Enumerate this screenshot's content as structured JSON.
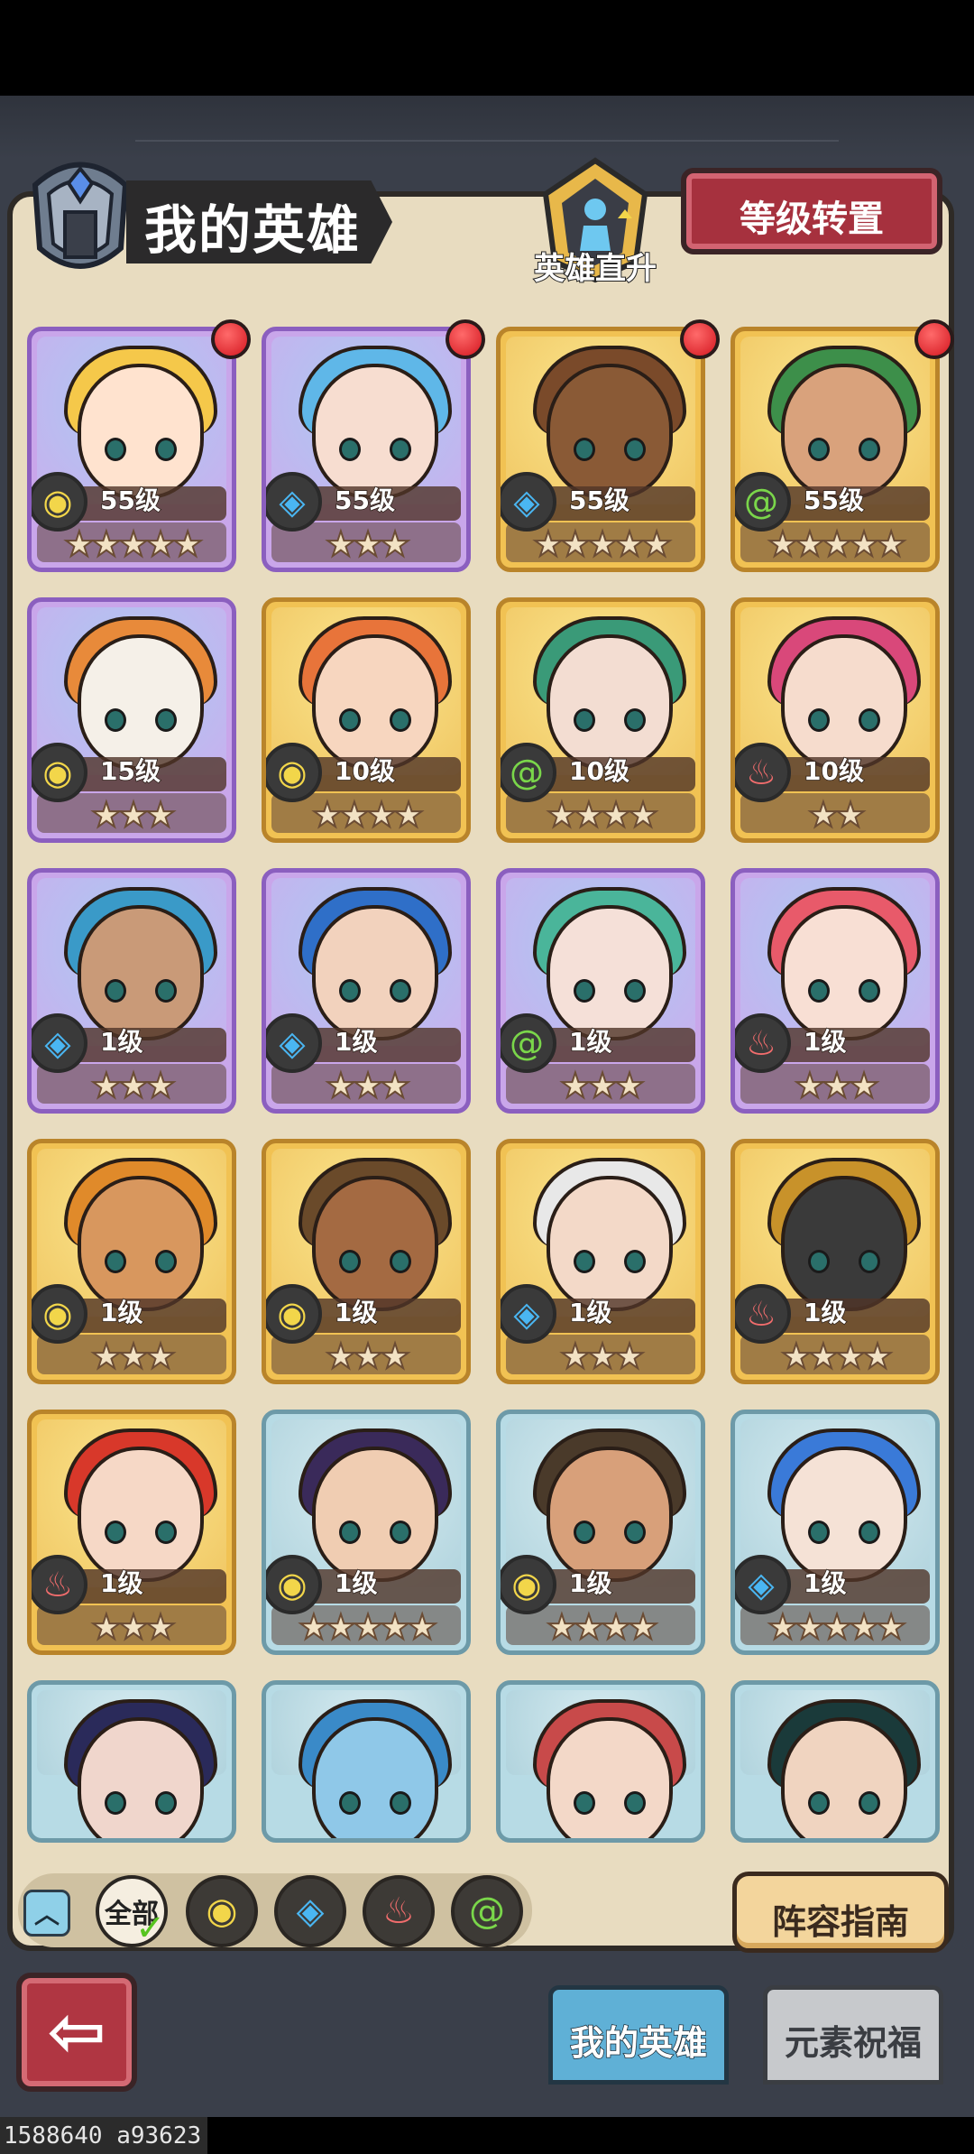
{
  "header": {
    "title": "我的英雄",
    "promote_label": "英雄直升",
    "transfer_label": "等级转置"
  },
  "heroes": [
    {
      "level": "55级",
      "stars": "★★★★★",
      "element": "earth",
      "frame": "purple",
      "hair": "#f5c84a",
      "skin": "#ffe3cf",
      "notify": true
    },
    {
      "level": "55级",
      "stars": "★★★",
      "element": "water",
      "frame": "purple",
      "hair": "#5fb7e8",
      "skin": "#f7ddd0",
      "notify": true
    },
    {
      "level": "55级",
      "stars": "★★★★★",
      "element": "water",
      "frame": "gold",
      "hair": "#7a4a2a",
      "skin": "#8a5a36",
      "notify": true
    },
    {
      "level": "55级",
      "stars": "★★★★★",
      "element": "wind",
      "frame": "gold",
      "hair": "#3d8f4a",
      "skin": "#d9a27c",
      "notify": true
    },
    {
      "level": "15级",
      "stars": "★★★",
      "element": "earth",
      "frame": "purple",
      "hair": "#e88a3a",
      "skin": "#f5f0e8",
      "notify": false
    },
    {
      "level": "10级",
      "stars": "★★★★",
      "element": "earth",
      "frame": "gold",
      "hair": "#e8743a",
      "skin": "#f7d6bf",
      "notify": false
    },
    {
      "level": "10级",
      "stars": "★★★★",
      "element": "wind",
      "frame": "gold",
      "hair": "#3a9a78",
      "skin": "#f3ddd2",
      "notify": false
    },
    {
      "level": "10级",
      "stars": "★★",
      "element": "fire",
      "frame": "gold",
      "hair": "#d9487a",
      "skin": "#f6dccd",
      "notify": false
    },
    {
      "level": "1级",
      "stars": "★★★",
      "element": "water",
      "frame": "purple",
      "hair": "#3a9ac8",
      "skin": "#c99a78",
      "notify": false
    },
    {
      "level": "1级",
      "stars": "★★★",
      "element": "water",
      "frame": "purple",
      "hair": "#2f6fc8",
      "skin": "#f2d2bd",
      "notify": false
    },
    {
      "level": "1级",
      "stars": "★★★",
      "element": "wind",
      "frame": "purple",
      "hair": "#4ab59a",
      "skin": "#f5e0d8",
      "notify": false
    },
    {
      "level": "1级",
      "stars": "★★★",
      "element": "fire",
      "frame": "purple",
      "hair": "#e85a6a",
      "skin": "#f8dfd4",
      "notify": false
    },
    {
      "level": "1级",
      "stars": "★★★",
      "element": "earth",
      "frame": "gold",
      "hair": "#e08a2a",
      "skin": "#d8975e",
      "notify": false
    },
    {
      "level": "1级",
      "stars": "★★★",
      "element": "earth",
      "frame": "gold",
      "hair": "#6a4a2a",
      "skin": "#a46a42",
      "notify": false
    },
    {
      "level": "1级",
      "stars": "★★★",
      "element": "water",
      "frame": "gold",
      "hair": "#e8e8e8",
      "skin": "#f3d9c8",
      "notify": false
    },
    {
      "level": "1级",
      "stars": "★★★★",
      "element": "fire",
      "frame": "gold",
      "hair": "#c8922a",
      "skin": "#3a3a3a",
      "notify": false
    },
    {
      "level": "1级",
      "stars": "★★★",
      "element": "fire",
      "frame": "gold",
      "hair": "#d8382a",
      "skin": "#f6d8c6",
      "notify": false
    },
    {
      "level": "1级",
      "stars": "★★★★★",
      "element": "earth",
      "frame": "blue",
      "hair": "#3a2a5a",
      "skin": "#f0cdb2",
      "notify": false
    },
    {
      "level": "1级",
      "stars": "★★★★",
      "element": "earth",
      "frame": "blue",
      "hair": "#4a3a2a",
      "skin": "#d8a07a",
      "notify": false
    },
    {
      "level": "1级",
      "stars": "★★★★★",
      "element": "water",
      "frame": "blue",
      "hair": "#3a7ad8",
      "skin": "#f5e2d6",
      "notify": false
    },
    {
      "level": "",
      "stars": "",
      "element": "",
      "frame": "blue",
      "hair": "#2a2a5a",
      "skin": "#f0d6cc",
      "notify": false
    },
    {
      "level": "",
      "stars": "",
      "element": "",
      "frame": "blue",
      "hair": "#3a8ac8",
      "skin": "#8fc8e8",
      "notify": false
    },
    {
      "level": "",
      "stars": "",
      "element": "",
      "frame": "blue",
      "hair": "#c84a4a",
      "skin": "#f3d8c8",
      "notify": false
    },
    {
      "level": "",
      "stars": "",
      "element": "",
      "frame": "blue",
      "hair": "#1a3a3a",
      "skin": "#f0d4c0",
      "notify": false
    }
  ],
  "filters": {
    "all_label": "全部",
    "elements": [
      "earth",
      "water",
      "fire",
      "wind"
    ]
  },
  "guide_label": "阵容指南",
  "tabs": {
    "my_heroes": "我的英雄",
    "element_blessing": "元素祝福"
  },
  "footer": "1588640 a93623",
  "icons": {
    "earth": "◉",
    "water": "◈",
    "fire": "♨",
    "wind": "@"
  },
  "colors": {
    "panel": "#e8dcc0",
    "accent_red": "#a6313e",
    "tab_active": "#5fb0d6"
  }
}
